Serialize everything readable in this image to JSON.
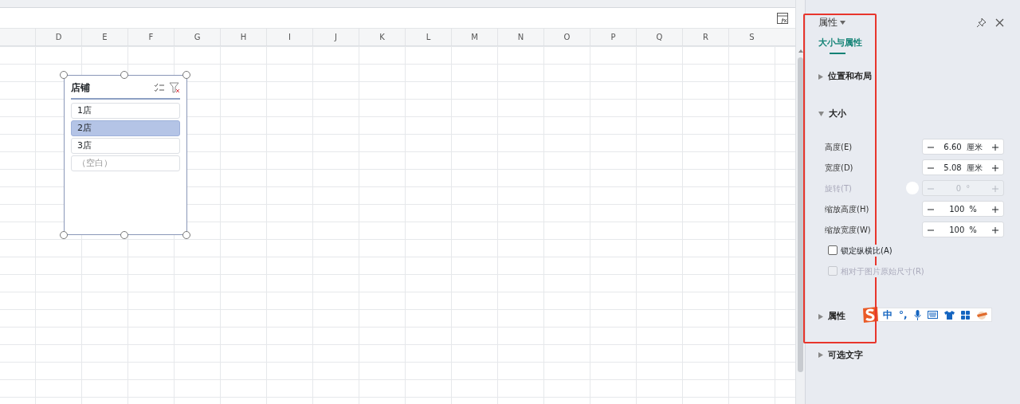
{
  "sheet": {
    "columns": [
      "D",
      "E",
      "F",
      "G",
      "H",
      "I",
      "J",
      "K",
      "L",
      "M",
      "N",
      "O",
      "P",
      "Q",
      "R",
      "S"
    ]
  },
  "slicer": {
    "title": "店铺",
    "items": [
      {
        "label": "1店",
        "selected": false,
        "kind": "item"
      },
      {
        "label": "2店",
        "selected": true,
        "kind": "item"
      },
      {
        "label": "3店",
        "selected": false,
        "kind": "item"
      },
      {
        "label": "（空白）",
        "selected": false,
        "kind": "blank"
      }
    ]
  },
  "panel": {
    "title": "属性",
    "tabs": [
      {
        "label": "大小与属性",
        "selected": true
      }
    ],
    "sections": [
      {
        "title": "位置和布局",
        "expanded": false
      },
      {
        "title": "大小",
        "expanded": true,
        "fields": [
          {
            "label": "高度(E)",
            "value": "6.60",
            "unit": "厘米",
            "disabled": false,
            "kind": "spin"
          },
          {
            "label": "宽度(D)",
            "value": "5.08",
            "unit": "厘米",
            "disabled": false,
            "kind": "spin"
          },
          {
            "label": "旋转(T)",
            "value": "0",
            "unit": "°",
            "disabled": true,
            "kind": "rotate"
          },
          {
            "label": "缩放高度(H)",
            "value": "100",
            "unit": "%",
            "disabled": false,
            "kind": "spin"
          },
          {
            "label": "缩放宽度(W)",
            "value": "100",
            "unit": "%",
            "disabled": false,
            "kind": "spin"
          }
        ],
        "checkboxes": [
          {
            "label": "锁定纵横比(A)",
            "checked": false,
            "disabled": false
          },
          {
            "label": "相对于图片原始尺寸(R)",
            "checked": false,
            "disabled": true
          }
        ]
      },
      {
        "title": "属性",
        "expanded": false
      },
      {
        "title": "可选文字",
        "expanded": false
      }
    ]
  },
  "ime_toolbar": {
    "items": [
      {
        "label": "中",
        "kind": "text"
      },
      {
        "label": "°,",
        "kind": "text"
      },
      {
        "kind": "mic"
      },
      {
        "kind": "keyboard"
      },
      {
        "kind": "shirt"
      },
      {
        "kind": "apps"
      },
      {
        "kind": "toolbox"
      }
    ]
  }
}
